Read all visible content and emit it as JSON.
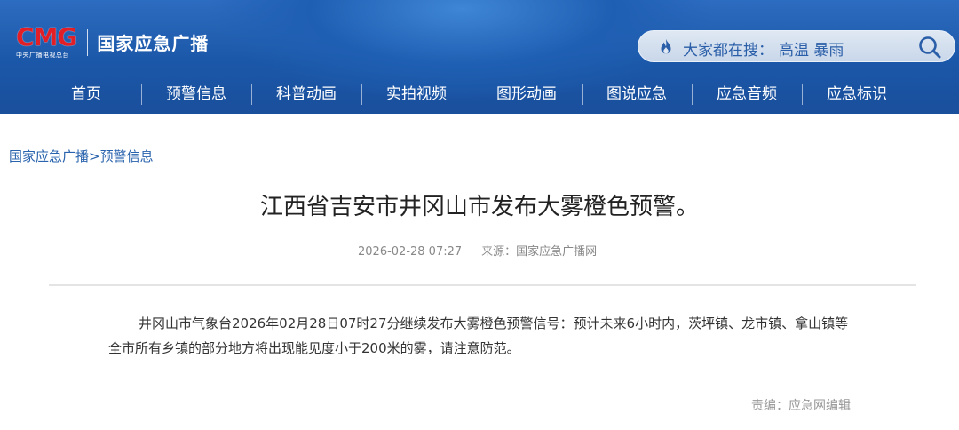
{
  "header": {
    "logo_text": "CMG",
    "logo_sub": "中央广播电视总台",
    "site_name": "国家应急广播",
    "search": {
      "label": "大家都在搜：",
      "keywords": "高温  暴雨"
    }
  },
  "nav": {
    "items": [
      {
        "label": "首页"
      },
      {
        "label": "预警信息"
      },
      {
        "label": "科普动画"
      },
      {
        "label": "实拍视频"
      },
      {
        "label": "图形动画"
      },
      {
        "label": "图说应急"
      },
      {
        "label": "应急音频"
      },
      {
        "label": "应急标识"
      }
    ]
  },
  "breadcrumb": {
    "home": "国家应急广播",
    "separator": ">",
    "current": "预警信息"
  },
  "article": {
    "title": "江西省吉安市井冈山市发布大雾橙色预警。",
    "datetime": "2026-02-28 07:27",
    "source": "来源：国家应急广播网",
    "body": "井冈山市气象台2026年02月28日07时27分继续发布大雾橙色预警信号：预计未来6小时内，茨坪镇、龙市镇、拿山镇等全市所有乡镇的部分地方将出现能见度小于200米的雾，请注意防范。",
    "editor": "责编：应急网编辑"
  },
  "colors": {
    "header_blue": "#1b57a8",
    "logo_red": "#e21f26",
    "link_blue": "#2a63ad"
  },
  "icons": [
    "flame-icon",
    "search-icon"
  ]
}
